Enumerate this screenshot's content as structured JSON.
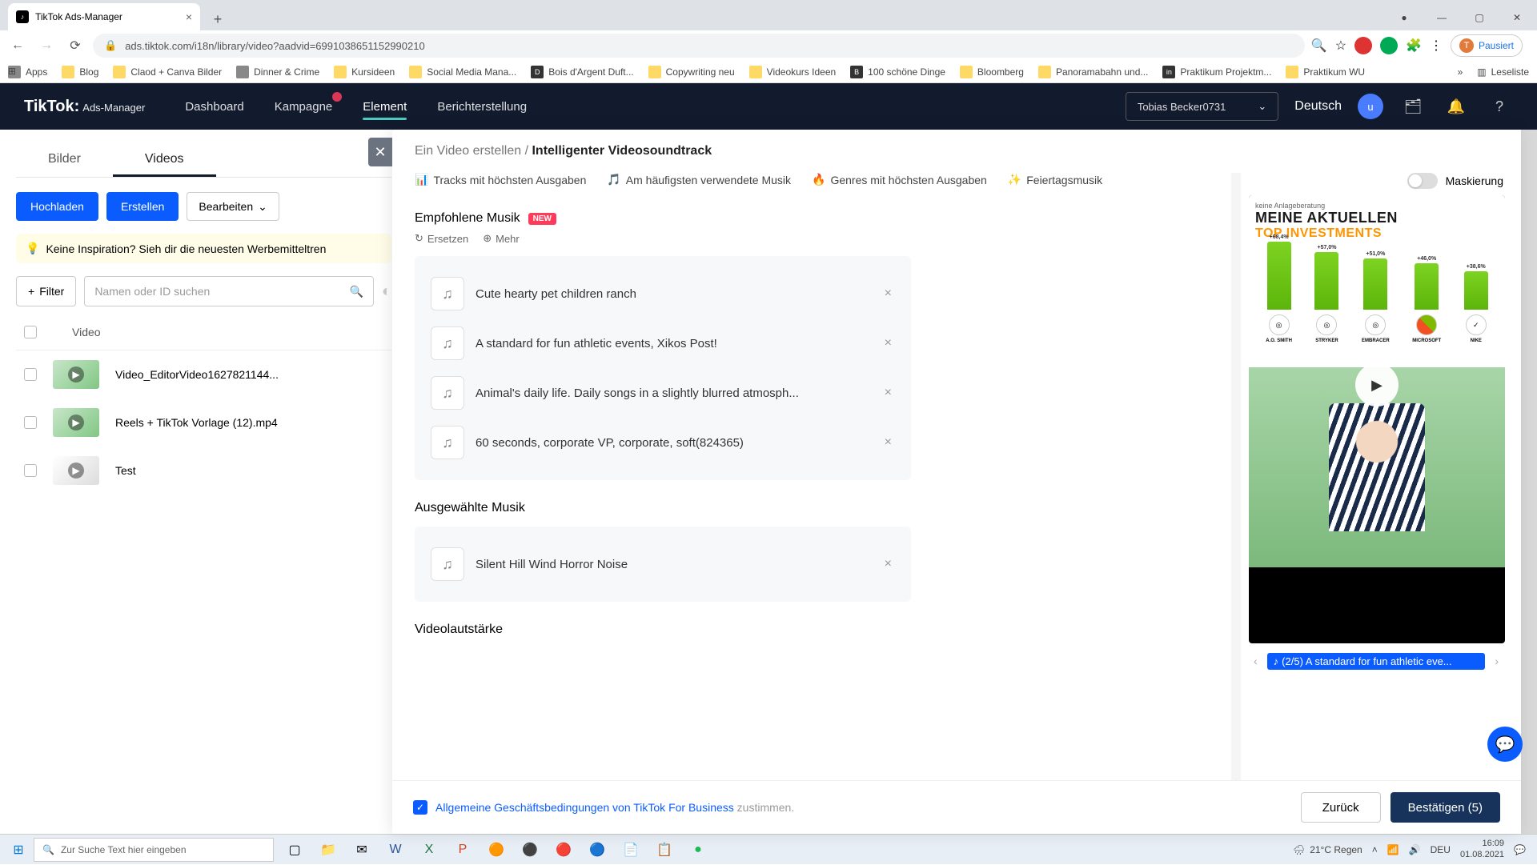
{
  "chrome": {
    "tab_title": "TikTok Ads-Manager",
    "url": "ads.tiktok.com/i18n/library/video?aadvid=6991038651152990210",
    "pause": "Pausiert",
    "bookmarks": [
      "Apps",
      "Blog",
      "Claod + Canva Bilder",
      "Dinner & Crime",
      "Kursideen",
      "Social Media Mana...",
      "Bois d'Argent Duft...",
      "Copywriting neu",
      "Videokurs Ideen",
      "100 schöne Dinge",
      "Bloomberg",
      "Panoramabahn und...",
      "Praktikum Projektm...",
      "Praktikum WU"
    ],
    "more": "Leseliste"
  },
  "header": {
    "logo_a": "TikTok:",
    "logo_b": "Ads-Manager",
    "tabs": [
      "Dashboard",
      "Kampagne",
      "Element",
      "Berichterstellung"
    ],
    "account": "Tobias Becker0731",
    "lang": "Deutsch"
  },
  "sidebar": {
    "tabs": [
      "Bilder",
      "Videos"
    ],
    "upload": "Hochladen",
    "create": "Erstellen",
    "edit": "Bearbeiten",
    "tip": "Keine Inspiration? Sieh dir die neuesten Werbemitteltren",
    "filter": "Filter",
    "search_ph": "Namen oder ID suchen",
    "col": "Video",
    "rows": [
      "Video_EditorVideo1627821144...",
      "Reels + TikTok Vorlage (12).mp4",
      "Test"
    ]
  },
  "modal": {
    "crumb_a": "Ein Video erstellen",
    "crumb_b": "Intelligenter Videosoundtrack",
    "cats": [
      "Tracks mit höchsten Ausgaben",
      "Am häufigsten verwendete Musik",
      "Genres mit höchsten Ausgaben",
      "Feiertagsmusik"
    ],
    "rec_title": "Empfohlene Musik",
    "new": "NEW",
    "replace": "Ersetzen",
    "more": "Mehr",
    "rec_tracks": [
      "Cute hearty pet children ranch",
      "A standard for fun athletic events, Xikos Post!",
      "Animal's daily life. Daily songs in a slightly blurred atmosph...",
      "60 seconds, corporate VP, corporate, soft(824365)"
    ],
    "sel_title": "Ausgewählte Musik",
    "sel_tracks": [
      "Silent Hill Wind Horror Noise"
    ],
    "volume": "Videolautstärke",
    "mask": "Maskierung",
    "nav_track": "(2/5) A standard for fun athletic eve...",
    "terms_a": "Allgemeine Geschäftsbedingungen von TikTok For Business",
    "terms_b": "zustimmen.",
    "back": "Zurück",
    "confirm": "Bestätigen (5)"
  },
  "preview": {
    "tag": "keine Anlageberatung",
    "t1": "MEINE AKTUELLEN",
    "t2": "TOP INVESTMENTS",
    "names": [
      "A.O. SMITH",
      "STRYKER",
      "EMBRACER",
      "MICROSOFT",
      "NIKE"
    ]
  },
  "chart_data": {
    "type": "bar",
    "categories": [
      "A.O. SMITH",
      "STRYKER",
      "EMBRACER",
      "MICROSOFT",
      "NIKE"
    ],
    "values": [
      68.4,
      57.0,
      51.0,
      46.0,
      38.6
    ],
    "title": "MEINE AKTUELLEN TOP INVESTMENTS",
    "ylabel": "%",
    "ylim": [
      0,
      100
    ]
  },
  "taskbar": {
    "search": "Zur Suche Text hier eingeben",
    "weather": "21°C  Regen",
    "lang": "DEU",
    "time": "16:09",
    "date": "01.08.2021"
  }
}
